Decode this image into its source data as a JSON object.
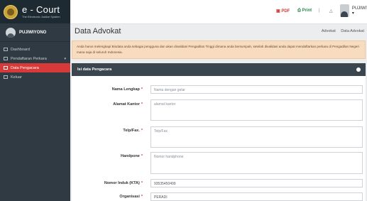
{
  "brand": {
    "title": "e - Court",
    "subtitle": "The Electronic Justice System"
  },
  "user": {
    "name": "PUJIWIYONO"
  },
  "sidebar": {
    "items": [
      {
        "label": "Dashboard"
      },
      {
        "label": "Pendaftaran Perkara",
        "caret": "▾"
      },
      {
        "label": "Data Pengacara"
      },
      {
        "label": "Keluar"
      }
    ]
  },
  "topbar": {
    "pdf_label": "PDF",
    "print_label": "Print",
    "separator": "|",
    "user_name": "PUJIWIYONO ▾"
  },
  "page": {
    "title": "Data Advokat",
    "breadcrumb": [
      "Advokat",
      "Data Advokat"
    ]
  },
  "alert": {
    "text": "Anda harus melengkapi Biodata anda sebagai pengguna dan akan divalidasi Pengadilan Tinggi dimana anda bersumpah, setelah divalidasi anda dapat mendaftarkan perkara di Pengadilan Negeri mana saja di seluruh Indonesia."
  },
  "panel": {
    "title": "Isi data Pengacara"
  },
  "form": {
    "fields": [
      {
        "label": "Nama Lengkap",
        "placeholder": "Nama dengan gelar"
      },
      {
        "label": "Alamat Kantor",
        "placeholder": "alamat kantor"
      },
      {
        "label": "Telp/Fax.",
        "placeholder": "Telp/Fax."
      },
      {
        "label": "Handpone",
        "placeholder": "Nomor handphone"
      },
      {
        "label": "Nomor Induk (KTA)",
        "value": "93535450499"
      },
      {
        "label": "Organisasi",
        "value": "PERADI"
      }
    ],
    "required_mark": "*"
  },
  "colors": {
    "sidebar_bg": "#2f3a42",
    "active_item": "#d83a3a",
    "alert_bg": "#f7dcc0"
  }
}
